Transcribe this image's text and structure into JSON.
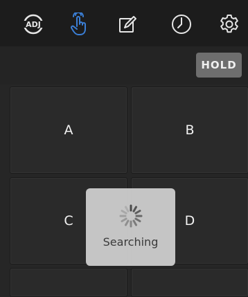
{
  "topbar": {
    "icons": [
      "adj-logo-icon",
      "touch-icon",
      "edit-icon",
      "clock-icon",
      "settings-gear-icon"
    ],
    "logo_text": "ADJ",
    "active_color": "#3b7fd6",
    "icon_color": "#e6e6e6"
  },
  "toolbar": {
    "hold_label": "HOLD"
  },
  "pads": {
    "a": "A",
    "b": "B",
    "c": "C",
    "d": "D"
  },
  "overlay": {
    "status_label": "Searching",
    "icon": "spinner-icon"
  }
}
